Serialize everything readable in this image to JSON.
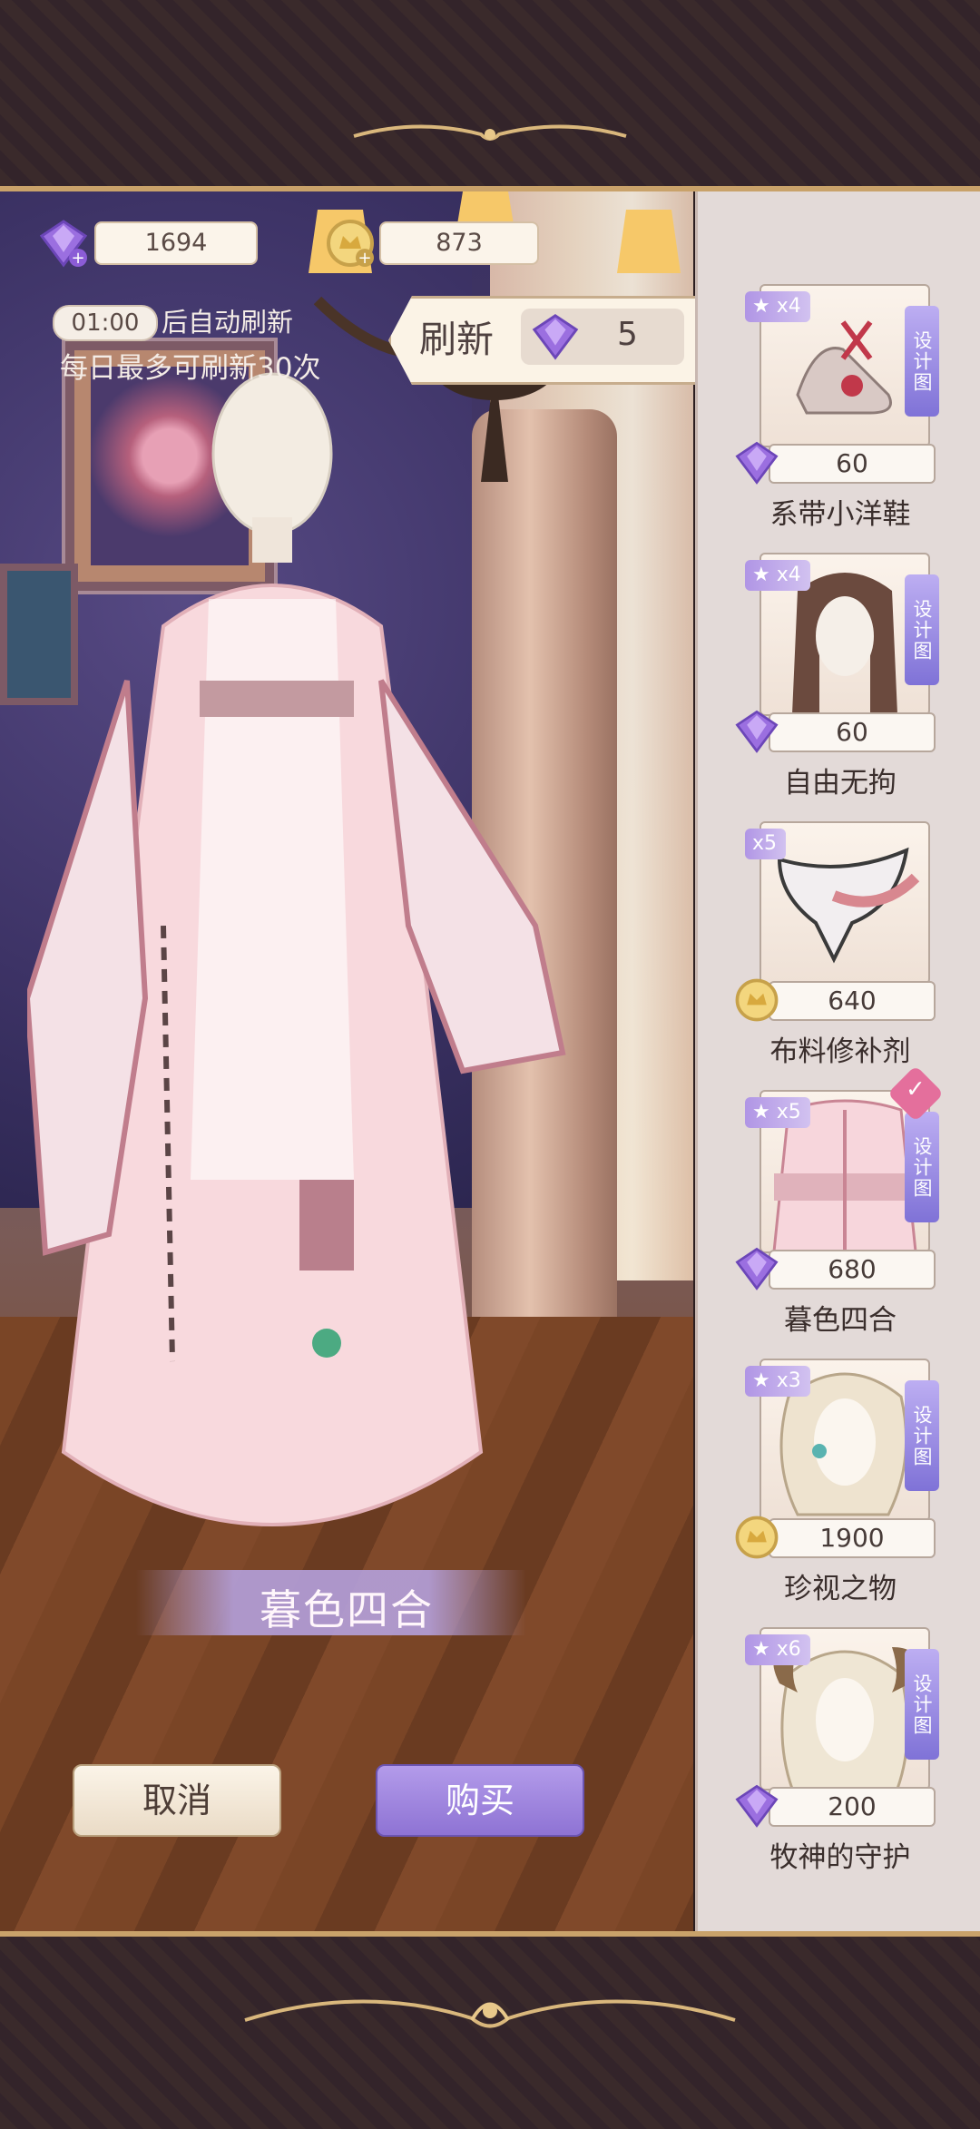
{
  "currency": {
    "diamonds": "1694",
    "coins": "873"
  },
  "refresh": {
    "timer": "01:00",
    "timer_suffix": "后自动刷新",
    "daily_limit": "每日最多可刷新30次",
    "label": "刷新",
    "cost": "5"
  },
  "outfit": {
    "name": "暮色四合"
  },
  "buttons": {
    "cancel": "取消",
    "buy": "购买"
  },
  "design_tag": "设计图",
  "items": [
    {
      "name": "系带小洋鞋",
      "count": "x4",
      "price": "60",
      "currency": "diamond",
      "design": true,
      "selected": false
    },
    {
      "name": "自由无拘",
      "count": "x4",
      "price": "60",
      "currency": "diamond",
      "design": true,
      "selected": false
    },
    {
      "name": "布料修补剂",
      "count": "x5",
      "price": "640",
      "currency": "coin",
      "design": false,
      "selected": false
    },
    {
      "name": "暮色四合",
      "count": "x5",
      "price": "680",
      "currency": "diamond",
      "design": true,
      "selected": true
    },
    {
      "name": "珍视之物",
      "count": "x3",
      "price": "1900",
      "currency": "coin",
      "design": true,
      "selected": false
    },
    {
      "name": "牧神的守护",
      "count": "x6",
      "price": "200",
      "currency": "diamond",
      "design": true,
      "selected": false
    }
  ]
}
